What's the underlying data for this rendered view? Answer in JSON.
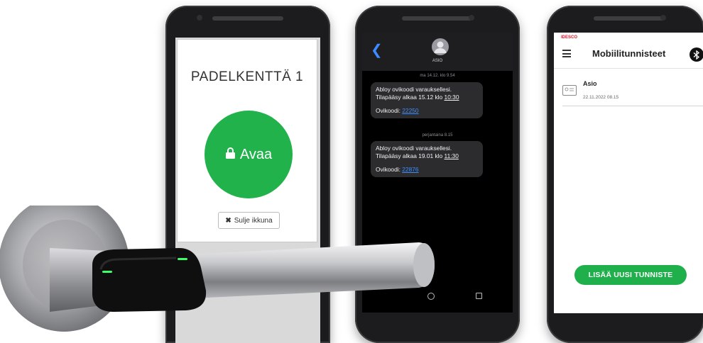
{
  "phone1": {
    "title": "PADELKENTTÄ 1",
    "open_label": "Avaa",
    "close_label": "Sulje ikkuna",
    "accent": "#22b24c"
  },
  "phone2": {
    "contact": "ASIO",
    "messages": [
      {
        "timestamp": "ma 14.12. klo 9.54",
        "line1": "Abloy ovikoodi varauksellesi.",
        "line2_prefix": "Tilapääsy alkaa 15.12 klo ",
        "time": "10:30",
        "code_label": "Ovikoodi: ",
        "code": "22250"
      },
      {
        "timestamp": "perjantaina 8.15",
        "line1": "Abloy ovikoodi varauksellesi.",
        "line2_prefix": "Tilapääsy alkaa 19.01 klo ",
        "time": "11:30",
        "code_label": "Ovikoodi: ",
        "code": "22876"
      }
    ],
    "link_color": "#3d8cff"
  },
  "phone3": {
    "brand": "IDESCO",
    "title": "Mobiilitunnisteet",
    "credential_name": "Asio",
    "credential_date": "22.11.2022 08.15",
    "add_button": "LISÄÄ UUSI TUNNISTE",
    "accent": "#1fb04b"
  },
  "icons": [
    "lock-icon",
    "close-x-icon",
    "back-chevron-icon",
    "contact-avatar-icon",
    "hamburger-menu-icon",
    "bluetooth-icon",
    "id-card-icon",
    "home-nav-icon",
    "recents-nav-icon"
  ]
}
